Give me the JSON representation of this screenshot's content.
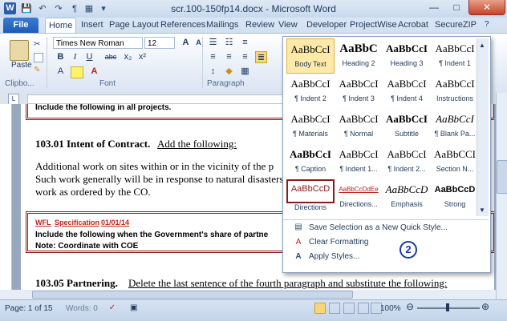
{
  "window": {
    "title": "scr.100-150fp14.docx - Microsoft Word",
    "logo": "W",
    "qat": [
      "save-icon",
      "undo-icon",
      "redo-icon",
      "paragraph-mark-icon",
      "table-icon",
      "customize-icon"
    ],
    "qat_glyphs": [
      "💾",
      "↶",
      "↷",
      "¶",
      "▦",
      "▾"
    ],
    "controls": {
      "minimize": "—",
      "maximize": "□",
      "close": "✕"
    }
  },
  "tabs": {
    "file": "File",
    "items": [
      "Home",
      "Insert",
      "Page Layout",
      "References",
      "Mailings",
      "Review",
      "View",
      "Developer",
      "ProjectWise",
      "Acrobat",
      "SecureZIP"
    ]
  },
  "ribbon": {
    "font_name": "Times New Roman",
    "font_size": "12",
    "paste_label": "Paste",
    "clipboard_label": "Clipbo...",
    "font_label": "Font",
    "paragraph_label": "Paragraph",
    "format_buttons": [
      "B",
      "I",
      "U",
      "abc",
      "x₂",
      "x²"
    ]
  },
  "gallery": {
    "styles": [
      {
        "preview": "AaBbCcI",
        "name": "Body Text"
      },
      {
        "preview": "AaBbC",
        "name": "Heading 2"
      },
      {
        "preview": "AaBbCcI",
        "name": "Heading 3"
      },
      {
        "preview": "AaBbCcI",
        "name": "¶ Indent 1"
      },
      {
        "preview": "AaBbCcI",
        "name": "¶ Indent 2"
      },
      {
        "preview": "AaBbCcI",
        "name": "¶ Indent 3"
      },
      {
        "preview": "AaBbCcI",
        "name": "¶ Indent 4"
      },
      {
        "preview": "AaBbCcI",
        "name": "Instructions"
      },
      {
        "preview": "AaBbCcI",
        "name": "¶ Materials"
      },
      {
        "preview": "AaBbCcI",
        "name": "¶ Normal"
      },
      {
        "preview": "AaBbCcI",
        "name": "Subtitle"
      },
      {
        "preview": "AaBbCcI",
        "name": "¶ Blank Pa..."
      },
      {
        "preview": "AaBbCcI",
        "name": "¶ Caption"
      },
      {
        "preview": "AaBbCcI",
        "name": "¶ Indent 1..."
      },
      {
        "preview": "AaBbCcI",
        "name": "¶ Indent 2..."
      },
      {
        "preview": "AaBbCCI",
        "name": "Section N..."
      },
      {
        "preview": "AaBbCcD",
        "name": "Directions"
      },
      {
        "preview": "AaBbCcDdEe",
        "name": "Directions..."
      },
      {
        "preview": "AaBbCcD",
        "name": "Emphasis"
      },
      {
        "preview": "AaBbCcD",
        "name": "Strong"
      }
    ],
    "menu": [
      {
        "label": "Save Selection as a New Quick Style...",
        "icon": "save-style-icon"
      },
      {
        "label": "Clear Formatting",
        "icon": "clear-formatting-icon"
      },
      {
        "label": "Apply Styles...",
        "icon": "apply-styles-icon"
      }
    ],
    "badge": "2"
  },
  "document": {
    "box1_text": "Include the following in all projects.",
    "heading1_num": "103.01 Intent of Contract.",
    "heading1_tail": "Add the following:",
    "para_lines": [
      "Additional work on sites within or in the vicinity of the p",
      "Such work generally will be in response to natural disasters",
      "work as ordered by the CO."
    ],
    "box2_tag1": "WFL",
    "box2_tag2": "Specification",
    "box2_date": "01/01/14",
    "box2_line1": "Include the following when the Government's share of partne",
    "box2_line2": "Note:  Coordinate with COE",
    "heading2_num": "103.05 Partnering.",
    "heading2_tail": "Delete the last sentence of the fourth paragraph and substitute the following:"
  },
  "status": {
    "page": "Page: 1 of 15",
    "words": "Words: 0",
    "zoom": "100%"
  }
}
